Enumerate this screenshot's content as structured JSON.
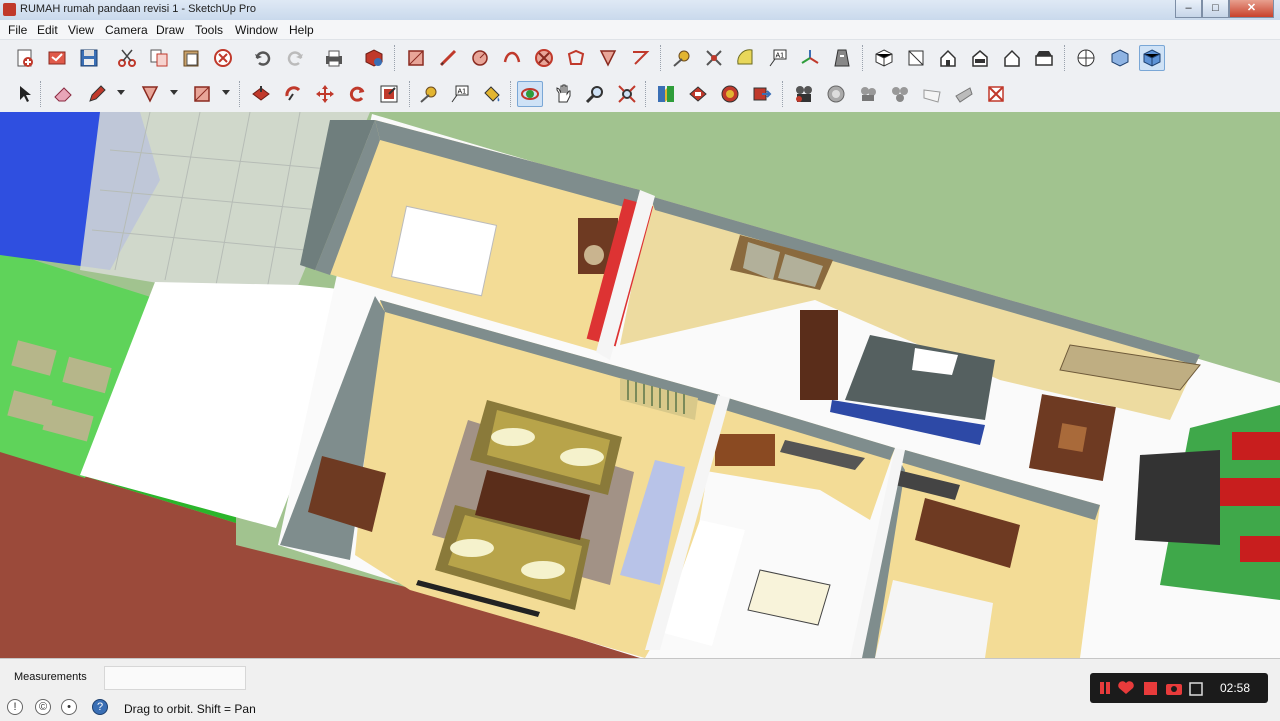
{
  "window": {
    "title": "RUMAH rumah pandaan revisi 1 - SketchUp Pro",
    "min": "–",
    "max": "□",
    "close": "✕"
  },
  "menu": [
    "File",
    "Edit",
    "View",
    "Camera",
    "Draw",
    "Tools",
    "Window",
    "Help"
  ],
  "toolbar_row1": [
    {
      "name": "new-icon"
    },
    {
      "name": "cut-icon"
    },
    {
      "name": "save-icon"
    },
    {
      "name": "scissors-icon"
    },
    {
      "name": "copy-icon"
    },
    {
      "name": "paste-icon"
    },
    {
      "name": "erase-icon"
    },
    {
      "name": "undo-icon"
    },
    {
      "name": "redo-icon"
    },
    {
      "name": "print-icon"
    },
    {
      "name": "model-info-icon"
    },
    {
      "name": "rectangle-icon"
    },
    {
      "name": "line-icon"
    },
    {
      "name": "circle-icon"
    },
    {
      "name": "arc-icon"
    },
    {
      "name": "polygon-icon"
    },
    {
      "name": "freehand-icon"
    },
    {
      "name": "move-icon"
    },
    {
      "name": "push-pull-icon"
    },
    {
      "name": "tape-measure-icon"
    },
    {
      "name": "dimension-icon"
    },
    {
      "name": "protractor-icon"
    },
    {
      "name": "text-icon"
    },
    {
      "name": "axes-icon"
    },
    {
      "name": "3d-text-icon"
    },
    {
      "name": "iso-view-icon"
    },
    {
      "name": "top-view-icon"
    },
    {
      "name": "front-view-icon"
    },
    {
      "name": "right-view-icon"
    },
    {
      "name": "back-view-icon"
    },
    {
      "name": "left-view-icon"
    },
    {
      "name": "xray-icon"
    },
    {
      "name": "wireframe-icon"
    },
    {
      "name": "shaded-icon"
    }
  ],
  "toolbar_row2": [
    {
      "name": "select-icon"
    },
    {
      "name": "eraser-icon"
    },
    {
      "name": "pencil-icon"
    },
    {
      "name": "rect-icon"
    },
    {
      "name": "push-icon"
    },
    {
      "name": "follow-me-icon"
    },
    {
      "name": "move-arrows-icon"
    },
    {
      "name": "rotate-icon"
    },
    {
      "name": "scale-icon"
    },
    {
      "name": "tape-icon"
    },
    {
      "name": "text-label-icon"
    },
    {
      "name": "paint-bucket-icon"
    },
    {
      "name": "orbit-icon"
    },
    {
      "name": "pan-icon"
    },
    {
      "name": "zoom-icon"
    },
    {
      "name": "zoom-extents-icon"
    },
    {
      "name": "components-icon"
    },
    {
      "name": "materials-icon"
    },
    {
      "name": "styles-icon"
    },
    {
      "name": "export-icon"
    },
    {
      "name": "walk-icon"
    },
    {
      "name": "look-around-icon"
    },
    {
      "name": "position-camera-icon"
    },
    {
      "name": "sandbox-icon"
    },
    {
      "name": "smoove-icon"
    },
    {
      "name": "stamp-icon"
    },
    {
      "name": "drape-icon"
    },
    {
      "name": "flip-edge-icon"
    }
  ],
  "statusbar": {
    "measurements_label": "Measurements",
    "hint": "Drag to orbit.  Shift = Pan",
    "help_glyph": "?"
  },
  "recorder": {
    "time": "02:58"
  }
}
